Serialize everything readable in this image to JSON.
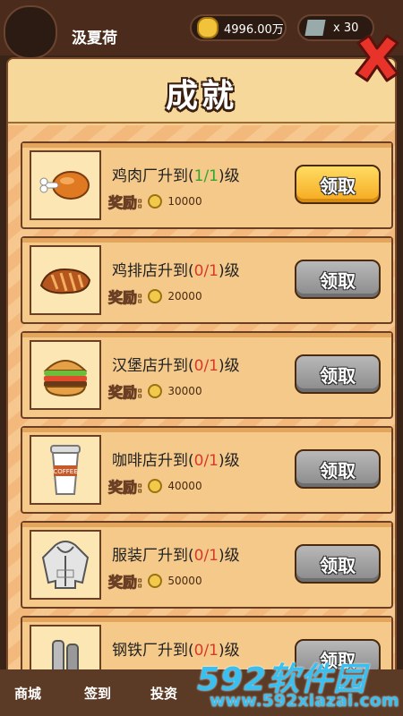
{
  "player": {
    "name": "汲夏荷",
    "coins": "4996.00万",
    "tickets": "x 30"
  },
  "panel": {
    "title": "成就"
  },
  "reward_label": "奖励:",
  "achievements": [
    {
      "icon": "chicken-leg-icon",
      "prefix": "鸡肉厂升到(",
      "progress": "1/1",
      "suffix": ")级",
      "reward": "10000",
      "claim": "领取",
      "claimable": true
    },
    {
      "icon": "chicken-steak-icon",
      "prefix": "鸡排店升到(",
      "progress": "0/1",
      "suffix": ")级",
      "reward": "20000",
      "claim": "领取",
      "claimable": false
    },
    {
      "icon": "burger-icon",
      "prefix": "汉堡店升到(",
      "progress": "0/1",
      "suffix": ")级",
      "reward": "30000",
      "claim": "领取",
      "claimable": false
    },
    {
      "icon": "coffee-cup-icon",
      "prefix": "咖啡店升到(",
      "progress": "0/1",
      "suffix": ")级",
      "reward": "40000",
      "claim": "领取",
      "claimable": false
    },
    {
      "icon": "hoodie-icon",
      "prefix": "服装厂升到(",
      "progress": "0/1",
      "suffix": ")级",
      "reward": "50000",
      "claim": "领取",
      "claimable": false
    },
    {
      "icon": "steel-icon",
      "prefix": "钢铁厂升到(",
      "progress": "0/1",
      "suffix": ")级",
      "reward": "",
      "claim": "领取",
      "claimable": false
    }
  ],
  "nav": [
    "商城",
    "签到",
    "投资"
  ],
  "watermark": {
    "big": "592软件园",
    "small": "www.592xiazai.com"
  }
}
